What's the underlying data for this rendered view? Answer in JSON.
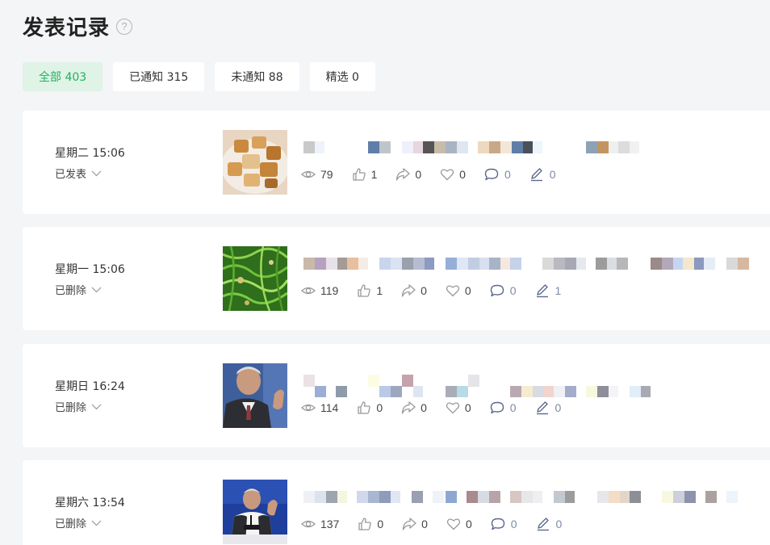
{
  "page": {
    "title": "发表记录",
    "help_icon": "question-circle-icon"
  },
  "tabs": [
    {
      "label": "全部 403",
      "active": true
    },
    {
      "label": "已通知 315",
      "active": false
    },
    {
      "label": "未通知 88",
      "active": false
    },
    {
      "label": "精选 0",
      "active": false
    }
  ],
  "posts": [
    {
      "time": "星期二 15:06",
      "status": "已发表",
      "thumbnail": "fried-tofu-photo",
      "stats": {
        "views": "79",
        "likes": "1",
        "shares": "0",
        "favorites": "0",
        "comments": "0",
        "edits": "0"
      }
    },
    {
      "time": "星期一 15:06",
      "status": "已删除",
      "thumbnail": "green-vegetable-photo",
      "stats": {
        "views": "119",
        "likes": "1",
        "shares": "0",
        "favorites": "0",
        "comments": "0",
        "edits": "1"
      }
    },
    {
      "time": "星期日 16:24",
      "status": "已删除",
      "thumbnail": "man-speaking-photo",
      "stats": {
        "views": "114",
        "likes": "0",
        "shares": "0",
        "favorites": "0",
        "comments": "0",
        "edits": "0"
      }
    },
    {
      "time": "星期六 13:54",
      "status": "已删除",
      "thumbnail": "press-conference-photo",
      "stats": {
        "views": "137",
        "likes": "0",
        "shares": "0",
        "favorites": "0",
        "comments": "0",
        "edits": "0"
      }
    }
  ],
  "icons": [
    "eye-icon",
    "thumbs-up-icon",
    "share-icon",
    "heart-icon",
    "comment-icon",
    "pen-icon",
    "chevron-down-icon"
  ],
  "colors": {
    "accent": "#1fb35e",
    "accent_bg": "#dff3e6",
    "background": "#f4f5f7"
  }
}
